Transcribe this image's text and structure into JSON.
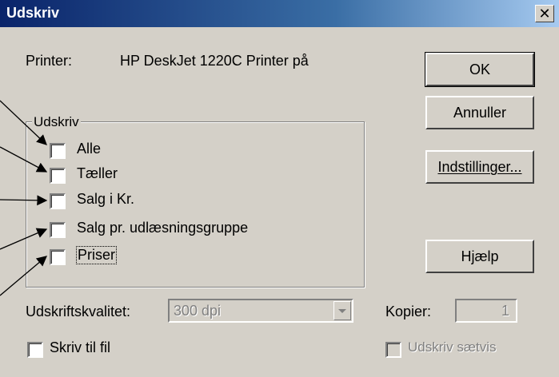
{
  "window": {
    "title": "Udskriv",
    "close_glyph": "✕"
  },
  "printer": {
    "label": "Printer:",
    "name": "HP DeskJet 1220C Printer på"
  },
  "buttons": {
    "ok": "OK",
    "cancel": "Annuller",
    "settings": "Indstillinger...",
    "help": "Hjælp"
  },
  "print_group": {
    "legend": "Udskriv",
    "options": [
      {
        "label": "Alle",
        "checked": false
      },
      {
        "label": "Tæller",
        "checked": false
      },
      {
        "label": "Salg i Kr.",
        "checked": false
      },
      {
        "label": "Salg pr. udlæsningsgruppe",
        "checked": false
      },
      {
        "label": "Priser",
        "checked": false
      }
    ]
  },
  "quality": {
    "label": "Udskriftskvalitet:",
    "value": "300 dpi"
  },
  "copies": {
    "label": "Kopier:",
    "value": "1"
  },
  "print_to_file": {
    "label": "Skriv til fil",
    "checked": false
  },
  "collate": {
    "label": "Udskriv sætvis",
    "checked": false,
    "enabled": false
  },
  "colors": {
    "face": "#d4d0c8",
    "title_start": "#0a246a",
    "title_end": "#a6caf0"
  }
}
